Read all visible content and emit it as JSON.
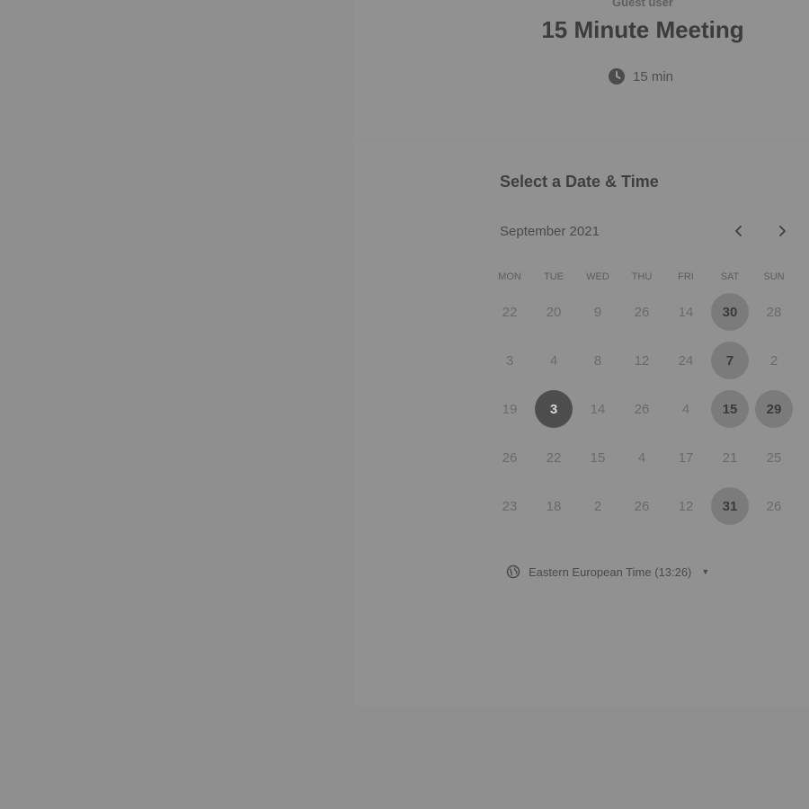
{
  "event": {
    "host": "Guest user",
    "title": "15 Minute Meeting",
    "duration": "15 min",
    "duration_icon": "clock-icon"
  },
  "scheduler": {
    "section_title": "Select a Date & Time",
    "month": "September 2021",
    "prev_icon": "chevron-left-icon",
    "next_icon": "chevron-right-icon",
    "weekdays": [
      "MON",
      "TUE",
      "WED",
      "THU",
      "FRI",
      "SAT",
      "SUN"
    ],
    "weeks": [
      [
        {
          "label": "22",
          "state": "unavailable"
        },
        {
          "label": "20",
          "state": "unavailable"
        },
        {
          "label": "9",
          "state": "unavailable"
        },
        {
          "label": "26",
          "state": "unavailable"
        },
        {
          "label": "14",
          "state": "unavailable"
        },
        {
          "label": "30",
          "state": "available"
        },
        {
          "label": "28",
          "state": "unavailable"
        }
      ],
      [
        {
          "label": "3",
          "state": "unavailable"
        },
        {
          "label": "4",
          "state": "unavailable"
        },
        {
          "label": "8",
          "state": "unavailable"
        },
        {
          "label": "12",
          "state": "unavailable"
        },
        {
          "label": "24",
          "state": "unavailable"
        },
        {
          "label": "7",
          "state": "available"
        },
        {
          "label": "2",
          "state": "unavailable"
        }
      ],
      [
        {
          "label": "19",
          "state": "unavailable"
        },
        {
          "label": "3",
          "state": "selected"
        },
        {
          "label": "14",
          "state": "unavailable"
        },
        {
          "label": "26",
          "state": "unavailable"
        },
        {
          "label": "4",
          "state": "unavailable"
        },
        {
          "label": "15",
          "state": "available"
        },
        {
          "label": "29",
          "state": "available"
        }
      ],
      [
        {
          "label": "26",
          "state": "unavailable"
        },
        {
          "label": "22",
          "state": "unavailable"
        },
        {
          "label": "15",
          "state": "unavailable"
        },
        {
          "label": "4",
          "state": "unavailable"
        },
        {
          "label": "17",
          "state": "unavailable"
        },
        {
          "label": "21",
          "state": "unavailable"
        },
        {
          "label": "25",
          "state": "unavailable"
        }
      ],
      [
        {
          "label": "23",
          "state": "unavailable"
        },
        {
          "label": "18",
          "state": "unavailable"
        },
        {
          "label": "2",
          "state": "unavailable"
        },
        {
          "label": "26",
          "state": "unavailable"
        },
        {
          "label": "12",
          "state": "unavailable"
        },
        {
          "label": "31",
          "state": "available"
        },
        {
          "label": "26",
          "state": "unavailable"
        }
      ]
    ],
    "timezone": {
      "label": "Eastern European Time (13:26)",
      "icon": "globe-icon",
      "dropdown_icon": "caret-down-icon"
    }
  }
}
